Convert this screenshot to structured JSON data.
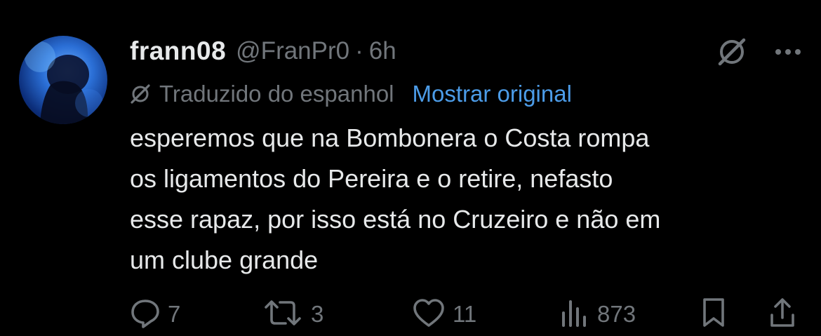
{
  "tweet": {
    "display_name": "frann08",
    "handle": "@FranPr0",
    "separator": "·",
    "time": "6h",
    "translated_label": "Traduzido do espanhol",
    "show_original_label": "Mostrar original",
    "text_lines": [
      "esperemos que na Bombonera o Costa rompa",
      "os ligamentos do Pereira e o retire, nefasto",
      "esse rapaz, por isso está no Cruzeiro e não em",
      "um clube grande"
    ],
    "actions": {
      "replies": "7",
      "reposts": "3",
      "likes": "11",
      "views": "873"
    },
    "icons": {
      "grok": "grok-icon",
      "more": "more-dots-icon",
      "translate": "translate-icon",
      "reply": "reply-icon",
      "repost": "repost-icon",
      "like": "heart-icon",
      "views": "views-chart-icon",
      "bookmark": "bookmark-icon",
      "share": "share-icon"
    },
    "colors": {
      "background": "#000000",
      "text": "#e7e9ea",
      "secondary": "#71767b",
      "link": "#4c9ce8"
    }
  }
}
